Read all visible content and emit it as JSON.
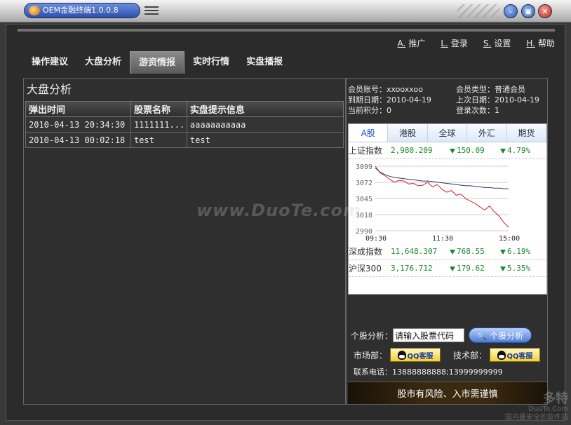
{
  "window": {
    "title": "OEM金融终端1.0.0.8"
  },
  "toplinks": [
    {
      "key": "A.",
      "label": "推广"
    },
    {
      "key": "L.",
      "label": "登录"
    },
    {
      "key": "S.",
      "label": "设置"
    },
    {
      "key": "H.",
      "label": "帮助"
    }
  ],
  "tabs": [
    {
      "label": "操作建议",
      "active": false
    },
    {
      "label": "大盘分析",
      "active": false
    },
    {
      "label": "游资情报",
      "active": true
    },
    {
      "label": "实时行情",
      "active": false
    },
    {
      "label": "实盘播报",
      "active": false
    }
  ],
  "left_panel": {
    "title": "大盘分析",
    "columns": [
      "弹出时间",
      "股票名称",
      "实盘提示信息"
    ],
    "rows": [
      [
        "2010-04-13 20:34:30",
        "1111111...",
        "aaaaaaaaaaa"
      ],
      [
        "2010-04-13 00:02:18",
        "test",
        "test"
      ]
    ]
  },
  "member": {
    "account": "会员账号：xxooxxoo",
    "type": "会员类型：普通会员",
    "expire": "到期日期：2010-04-19",
    "last_date": "上次日期：2010-04-19",
    "points": "当前积分：0",
    "logins": "登录次数：1"
  },
  "market_tabs": [
    {
      "label": "A股",
      "active": true
    },
    {
      "label": "港股",
      "active": false
    },
    {
      "label": "全球",
      "active": false
    },
    {
      "label": "外汇",
      "active": false
    },
    {
      "label": "期货",
      "active": false
    }
  ],
  "indices": [
    {
      "name": "上证指数",
      "value": "2,980.209",
      "change": "150.09",
      "pct": "4.79%"
    },
    {
      "name": "深成指数",
      "value": "11,648.307",
      "change": "768.55",
      "pct": "6.19%"
    },
    {
      "name": "沪深300",
      "value": "3,176.712",
      "change": "179.62",
      "pct": "5.35%"
    }
  ],
  "chart_data": {
    "type": "line",
    "yticks": [
      "3099",
      "3072",
      "3045",
      "3018",
      "2990"
    ],
    "xticks": [
      "09:30",
      "11:30",
      "15:00"
    ],
    "ylim": [
      2990,
      3099
    ],
    "series": [
      {
        "color": "#d42020",
        "values": [
          3099,
          3088,
          3083,
          3077,
          3072,
          3075,
          3074,
          3069,
          3070,
          3066,
          3067,
          3072,
          3064,
          3068,
          3060,
          3055,
          3058,
          3050,
          3052,
          3044,
          3040,
          3036,
          3030,
          3025,
          3032,
          3022,
          3015,
          3004,
          2996
        ]
      },
      {
        "color": "#2a3a66",
        "values": [
          3096,
          3089,
          3085,
          3082,
          3080,
          3079,
          3078,
          3077,
          3076,
          3075,
          3074,
          3074,
          3073,
          3072,
          3071,
          3070,
          3069,
          3068,
          3067,
          3066,
          3066,
          3065,
          3064,
          3063,
          3063,
          3062,
          3062,
          3061,
          3061
        ]
      }
    ],
    "colors": {
      "up_down": "#1a8a28",
      "grid": "#cccccc"
    }
  },
  "stock_tools": {
    "label": "个股分析：",
    "placeholder": "请输入股票代码",
    "button": "个股分析",
    "market_label": "市场部：",
    "tech_label": "技术部：",
    "qq_label": "QQ客服",
    "phone": "联系电话：13888888888;13999999999"
  },
  "banner": {
    "text": "股市有风险、入市需谨慎"
  },
  "watermark": {
    "main": "www.DuoTe.com",
    "corner_top": "多特",
    "corner_mid": "DuoTe.Com",
    "corner_bottom": "国内最安全的软件站"
  }
}
